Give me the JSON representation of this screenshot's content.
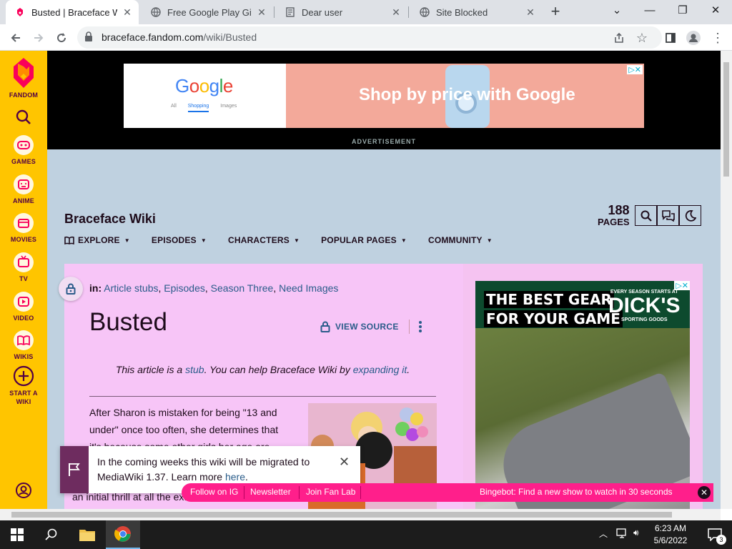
{
  "browser": {
    "tabs": [
      {
        "title": "Busted | Braceface Wiki | Fandom",
        "active": true
      },
      {
        "title": "Free Google Play Gift Cards",
        "active": false
      },
      {
        "title": "Dear user",
        "active": false
      },
      {
        "title": "Site Blocked",
        "active": false
      }
    ],
    "url_domain": "braceface.fandom.com",
    "url_path": "/wiki/Busted"
  },
  "rail": {
    "brand": "FANDOM",
    "items": [
      {
        "label": "GAMES",
        "icon": "games-icon"
      },
      {
        "label": "ANIME",
        "icon": "anime-icon"
      },
      {
        "label": "MOVIES",
        "icon": "movies-icon"
      },
      {
        "label": "TV",
        "icon": "tv-icon"
      },
      {
        "label": "VIDEO",
        "icon": "video-icon"
      },
      {
        "label": "WIKIS",
        "icon": "wikis-icon"
      },
      {
        "label": "START A WIKI",
        "icon": "plus-circle-icon"
      }
    ]
  },
  "top_ad": {
    "google": "Google",
    "tabs": [
      "All",
      "Shopping",
      "Images"
    ],
    "headline": "Shop by price with Google",
    "label": "ADVERTISEMENT"
  },
  "wiki": {
    "name": "Braceface Wiki",
    "pages_count": "188",
    "pages_label": "PAGES",
    "nav": [
      "EXPLORE",
      "EPISODES",
      "CHARACTERS",
      "POPULAR PAGES",
      "COMMUNITY"
    ]
  },
  "article": {
    "categories_label": "in:",
    "categories": [
      "Article stubs",
      "Episodes",
      "Season Three",
      "Need Images"
    ],
    "title": "Busted",
    "view_source": "VIEW SOURCE",
    "stub_pre": "This article is a ",
    "stub_link1": "stub",
    "stub_mid": ". You can help Braceface Wiki by ",
    "stub_link2": "expanding it",
    "stub_post": ".",
    "body_lines": [
      "After Sharon is mistaken for being \"13 and",
      "under\" once too often, she determines that",
      "it's because some other girls her age are"
    ],
    "body_tail": "an initial thrill at all the extra attention her"
  },
  "side_ad": {
    "line1": "THE BEST GEAR",
    "line2": "FOR YOUR GAME",
    "small": "EVERY SEASON STARTS AT",
    "brand": "DICK'S",
    "sub": "SPORTING GOODS"
  },
  "notice": {
    "text_pre": "In the coming weeks this wiki will be migrated to MediaWiki 1.37. Learn more ",
    "link": "here",
    "text_post": "."
  },
  "footer_bar": {
    "links": [
      "Follow on IG",
      "Newsletter",
      "Join Fan Lab"
    ],
    "bingebot": "Bingebot: Find a new show to watch in 30 seconds"
  },
  "taskbar": {
    "time": "6:23 AM",
    "date": "5/6/2022",
    "notifications": "3"
  },
  "colors": {
    "rail": "#ffc500",
    "page_bg": "#bfd1e0",
    "content_bg": "#f7c5f7",
    "link": "#2a5c8a",
    "footer_bar": "#ff1f8b"
  }
}
